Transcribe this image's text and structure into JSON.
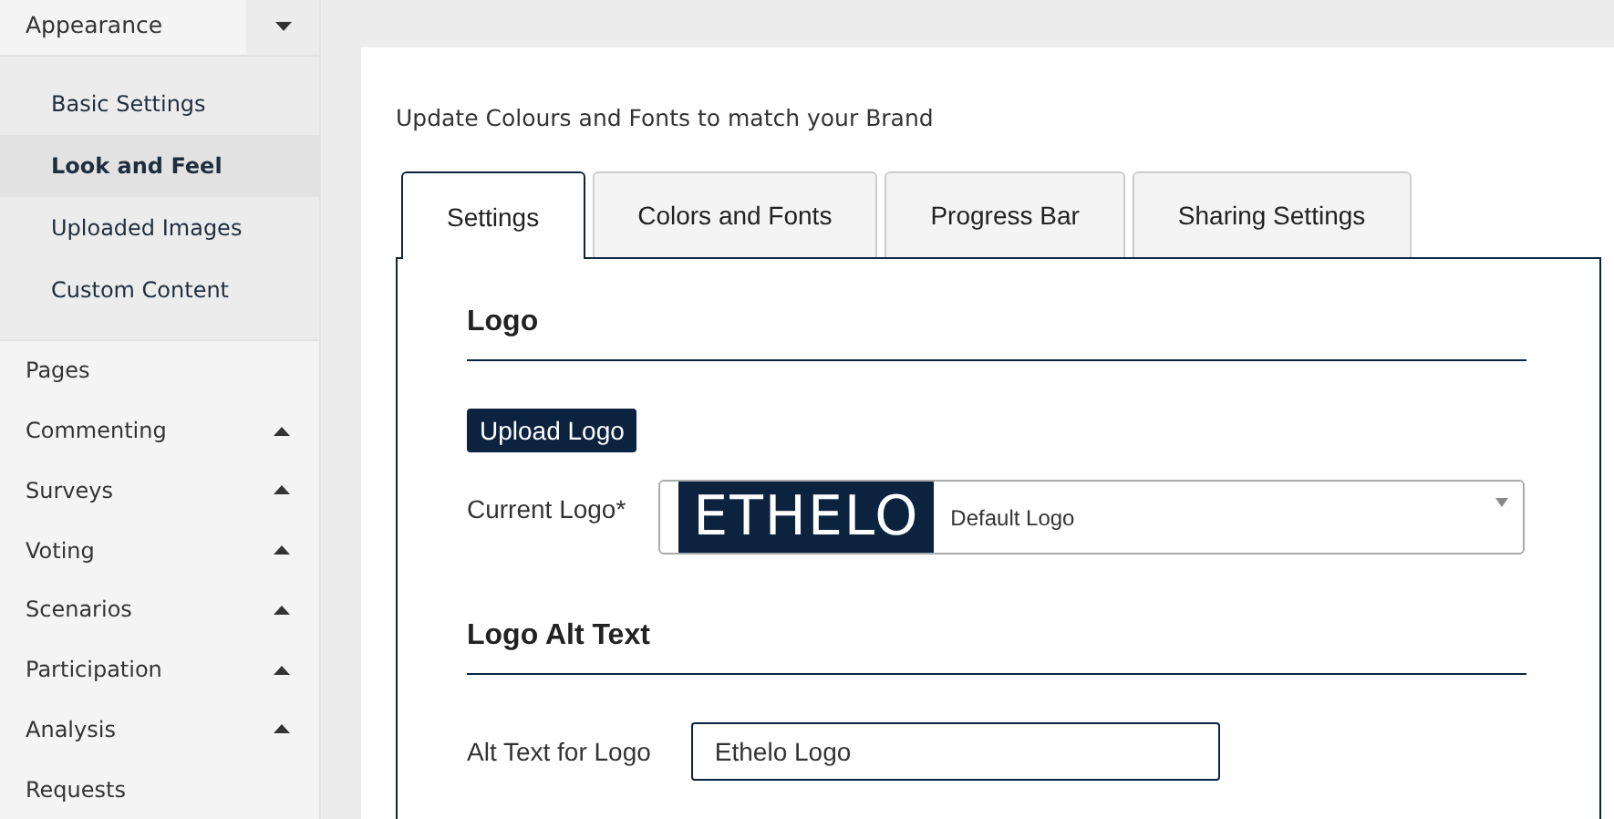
{
  "sidebar": {
    "group": {
      "label": "Appearance",
      "expanded": true,
      "items": [
        {
          "label": "Basic Settings",
          "selected": false
        },
        {
          "label": "Look and Feel",
          "selected": true
        },
        {
          "label": "Uploaded Images",
          "selected": false
        },
        {
          "label": "Custom Content",
          "selected": false
        }
      ]
    },
    "items": [
      {
        "label": "Pages",
        "has_caret": false
      },
      {
        "label": "Commenting",
        "has_caret": true
      },
      {
        "label": "Surveys",
        "has_caret": true
      },
      {
        "label": "Voting",
        "has_caret": true
      },
      {
        "label": "Scenarios",
        "has_caret": true
      },
      {
        "label": "Participation",
        "has_caret": true
      },
      {
        "label": "Analysis",
        "has_caret": true
      },
      {
        "label": "Requests",
        "has_caret": false
      }
    ]
  },
  "main": {
    "description": "Update Colours and Fonts to match your Brand",
    "tabs": [
      {
        "label": "Settings",
        "selected": true
      },
      {
        "label": "Colors and Fonts",
        "selected": false
      },
      {
        "label": "Progress Bar",
        "selected": false
      },
      {
        "label": "Sharing Settings",
        "selected": false
      }
    ],
    "logo_section": {
      "heading": "Logo",
      "upload_button": "Upload Logo",
      "current_logo_label": "Current Logo*",
      "select": {
        "logo_text": "ETHELO",
        "value": "Default Logo"
      }
    },
    "alt_section": {
      "heading": "Logo Alt Text",
      "field_label": "Alt Text for Logo",
      "field_value": "Ethelo Logo"
    }
  }
}
